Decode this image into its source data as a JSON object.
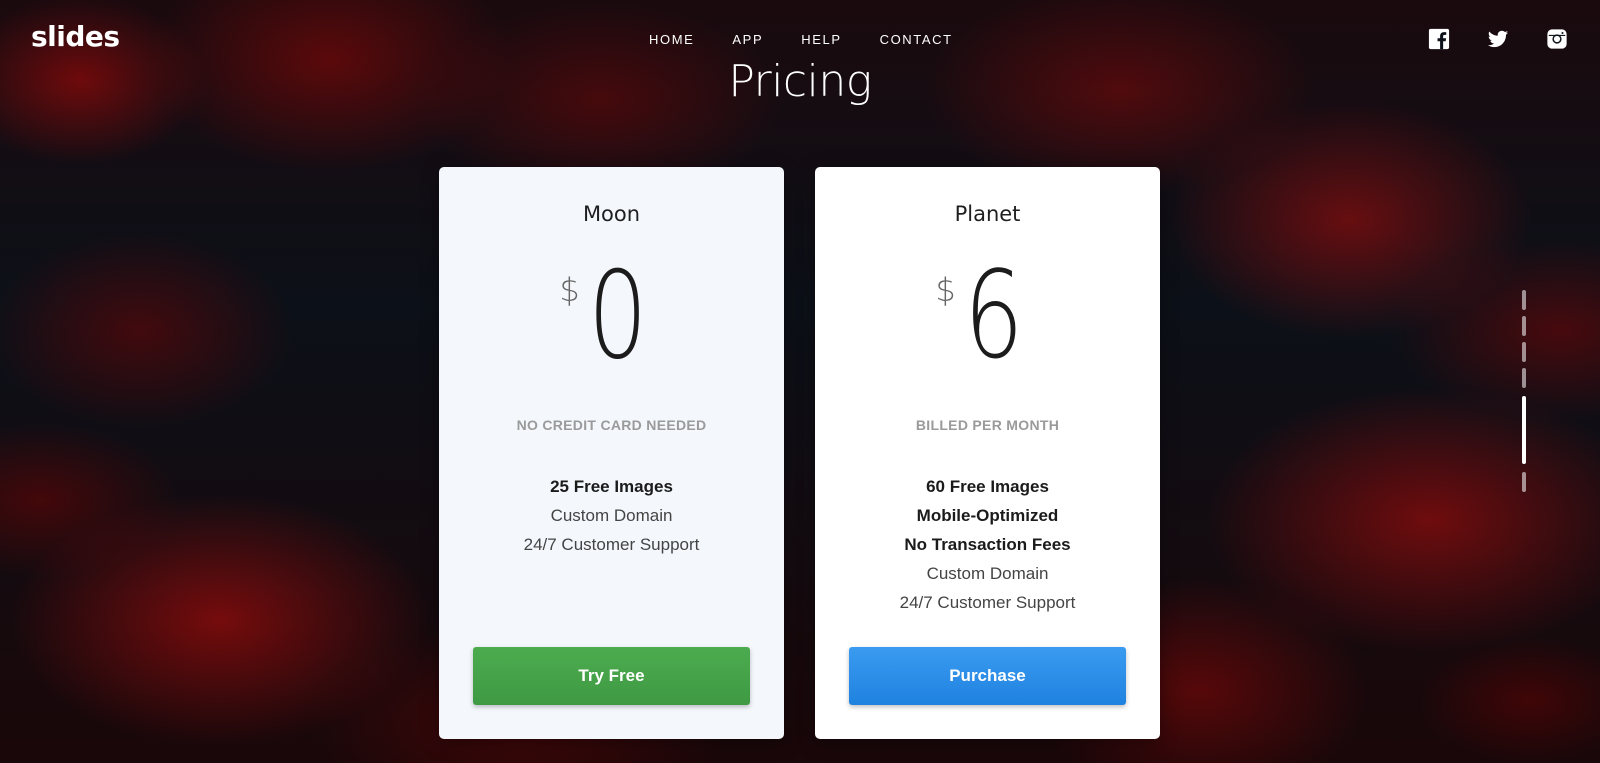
{
  "brand": {
    "logo_text": "slides"
  },
  "nav": {
    "items": [
      {
        "label": "HOME"
      },
      {
        "label": "APP"
      },
      {
        "label": "HELP"
      },
      {
        "label": "CONTACT"
      }
    ]
  },
  "social": {
    "icons": [
      "facebook-icon",
      "twitter-icon",
      "instagram-icon"
    ]
  },
  "page": {
    "title": "Pricing"
  },
  "plans": [
    {
      "name": "Moon",
      "currency": "$",
      "price": "0",
      "note": "NO CREDIT CARD NEEDED",
      "features": [
        {
          "text": "25 Free Images",
          "bold": true
        },
        {
          "text": "Custom Domain",
          "bold": false
        },
        {
          "text": "24/7 Customer Support",
          "bold": false
        }
      ],
      "button_label": "Try Free",
      "button_color": "#45a349"
    },
    {
      "name": "Planet",
      "currency": "$",
      "price": "6",
      "note": "BILLED PER MONTH",
      "features": [
        {
          "text": "60 Free Images",
          "bold": true
        },
        {
          "text": "Mobile-Optimized",
          "bold": true
        },
        {
          "text": "No Transaction Fees",
          "bold": true
        },
        {
          "text": "Custom Domain",
          "bold": false
        },
        {
          "text": "24/7 Customer Support",
          "bold": false
        }
      ],
      "button_label": "Purchase",
      "button_color": "#2a8de6"
    }
  ],
  "slide_nav": {
    "count": 6,
    "active_index": 4
  }
}
